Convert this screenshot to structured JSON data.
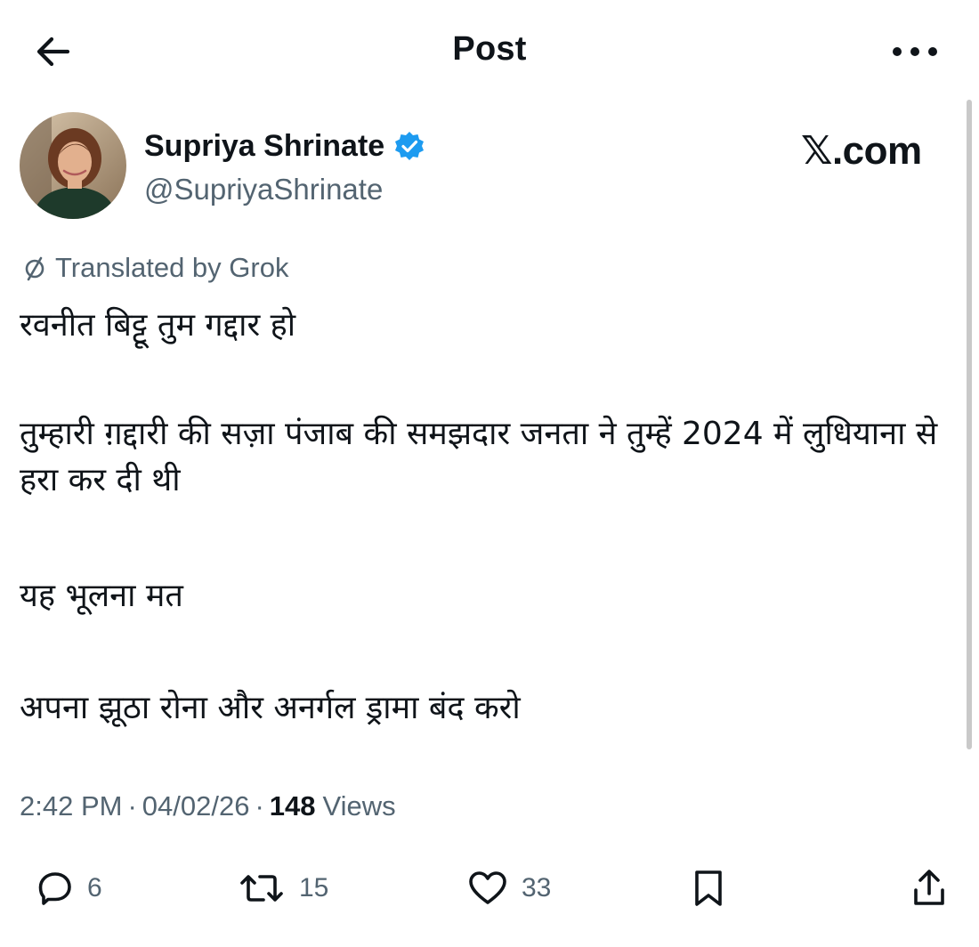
{
  "header": {
    "title": "Post",
    "back_icon": "arrow-left-icon",
    "more_icon": "more-horizontal-icon"
  },
  "author": {
    "name": "Supriya Shrinate",
    "handle": "@SupriyaShrinate",
    "verified": true,
    "verified_color": "#1d9bf0"
  },
  "watermark": "𝕏.com",
  "translation_label": "Translated by Grok",
  "post": {
    "paragraphs": [
      "रवनीत बिट्टू तुम गद्दार हो",
      "तुम्हारी ग़द्दारी की सज़ा पंजाब की समझदार जनता ने तुम्हें 2024 में लुधियाना से हरा कर दी थी",
      "यह भूलना मत",
      "अपना झूठा रोना और अनर्गल ड्रामा बंद करो"
    ]
  },
  "meta": {
    "time": "2:42 PM",
    "date": "04/02/26",
    "separator": "·",
    "views_count": "148",
    "views_label": "Views"
  },
  "actions": {
    "replies": "6",
    "reposts": "15",
    "likes": "33"
  },
  "colors": {
    "text": "#0f1419",
    "muted": "#536471",
    "accent": "#1d9bf0"
  }
}
